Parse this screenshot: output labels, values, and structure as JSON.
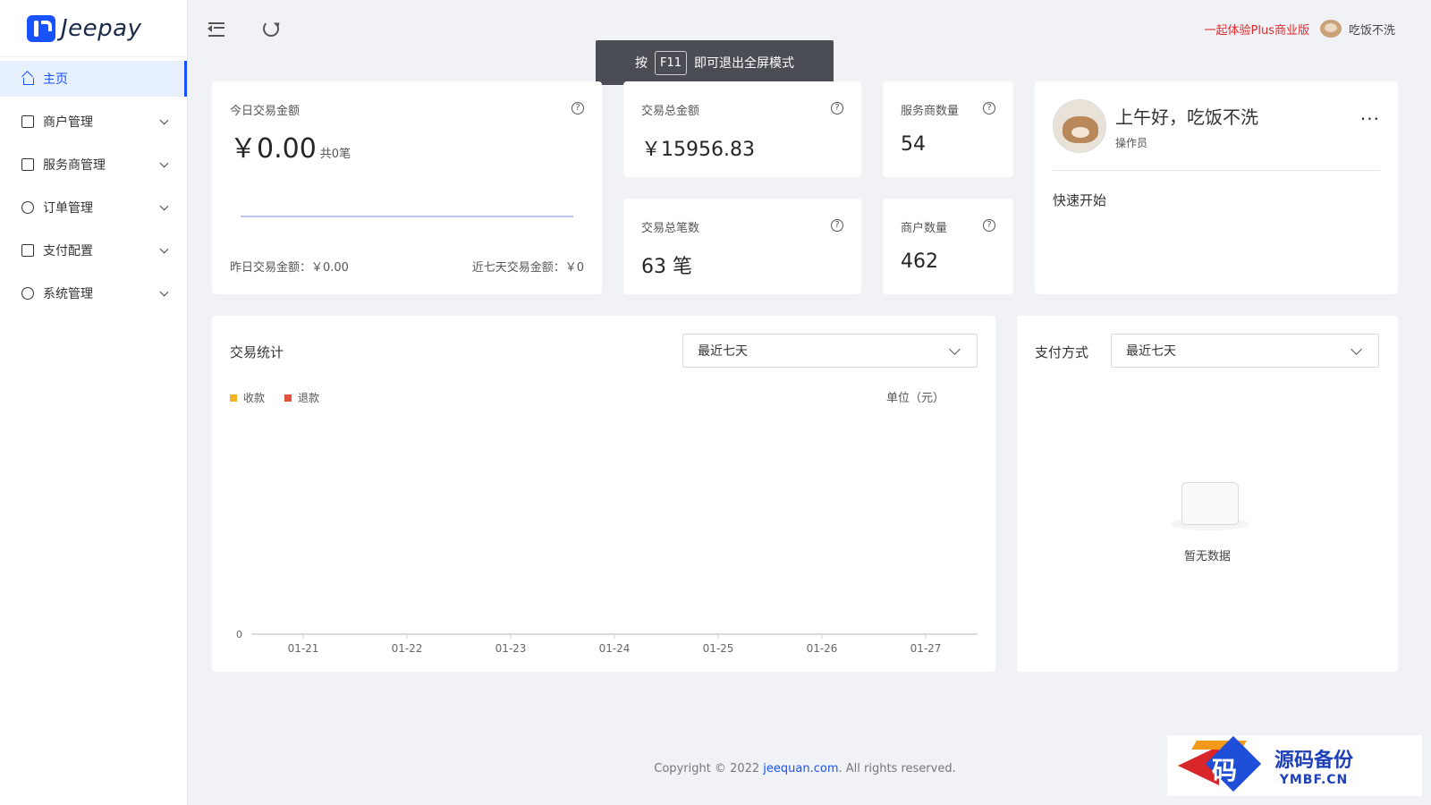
{
  "brand": {
    "name": "Jeepay",
    "accent": "#1953ff"
  },
  "sidebar": {
    "items": [
      {
        "label": "主页",
        "icon": "home-icon",
        "active": true
      },
      {
        "label": "商户管理",
        "icon": "store-icon"
      },
      {
        "label": "服务商管理",
        "icon": "provider-icon"
      },
      {
        "label": "订单管理",
        "icon": "order-icon"
      },
      {
        "label": "支付配置",
        "icon": "payment-config-icon"
      },
      {
        "label": "系统管理",
        "icon": "gear-icon"
      }
    ]
  },
  "header": {
    "promo": "一起体验Plus商业版",
    "username": "吃饭不洗",
    "icons": [
      "menu-fold-icon",
      "reload-icon"
    ]
  },
  "fullscreen_tip": {
    "prefix": "按",
    "key": "F11",
    "suffix": "即可退出全屏模式"
  },
  "cards": {
    "today": {
      "label": "今日交易金额",
      "amount": "￥0.00",
      "count": "共0笔",
      "yesterday": "昨日交易金额：￥0.00",
      "last7": "近七天交易金额：￥0"
    },
    "total_amount": {
      "label": "交易总金额",
      "value": "￥15956.83"
    },
    "total_count": {
      "label": "交易总笔数",
      "value": "63 笔"
    },
    "providers": {
      "label": "服务商数量",
      "value": "54"
    },
    "merchants": {
      "label": "商户数量",
      "value": "462"
    }
  },
  "welcome": {
    "greeting": "上午好，吃饭不洗",
    "role": "操作员",
    "more": "···",
    "quick_start": "快速开始"
  },
  "stats": {
    "title": "交易统计",
    "range": "最近七天",
    "unit": "单位（元）",
    "legend": [
      {
        "name": "收款",
        "color": "#f0b323"
      },
      {
        "name": "退款",
        "color": "#e0533a"
      }
    ]
  },
  "chart_data": {
    "type": "line",
    "categories": [
      "01-21",
      "01-22",
      "01-23",
      "01-24",
      "01-25",
      "01-26",
      "01-27"
    ],
    "series": [
      {
        "name": "收款",
        "values": [
          0,
          0,
          0,
          0,
          0,
          0,
          0
        ]
      },
      {
        "name": "退款",
        "values": [
          0,
          0,
          0,
          0,
          0,
          0,
          0
        ]
      }
    ],
    "y_ticks": [
      "0"
    ],
    "ylabel": "单位（元）"
  },
  "payment": {
    "title": "支付方式",
    "range": "最近七天",
    "empty": "暂无数据"
  },
  "footer": {
    "prefix": "Copyright © 2022 ",
    "link": "jeequan.com",
    "suffix": ". All rights reserved."
  },
  "watermark": {
    "cn": "源码备份",
    "en": "YMBF.CN",
    "char": "码"
  }
}
